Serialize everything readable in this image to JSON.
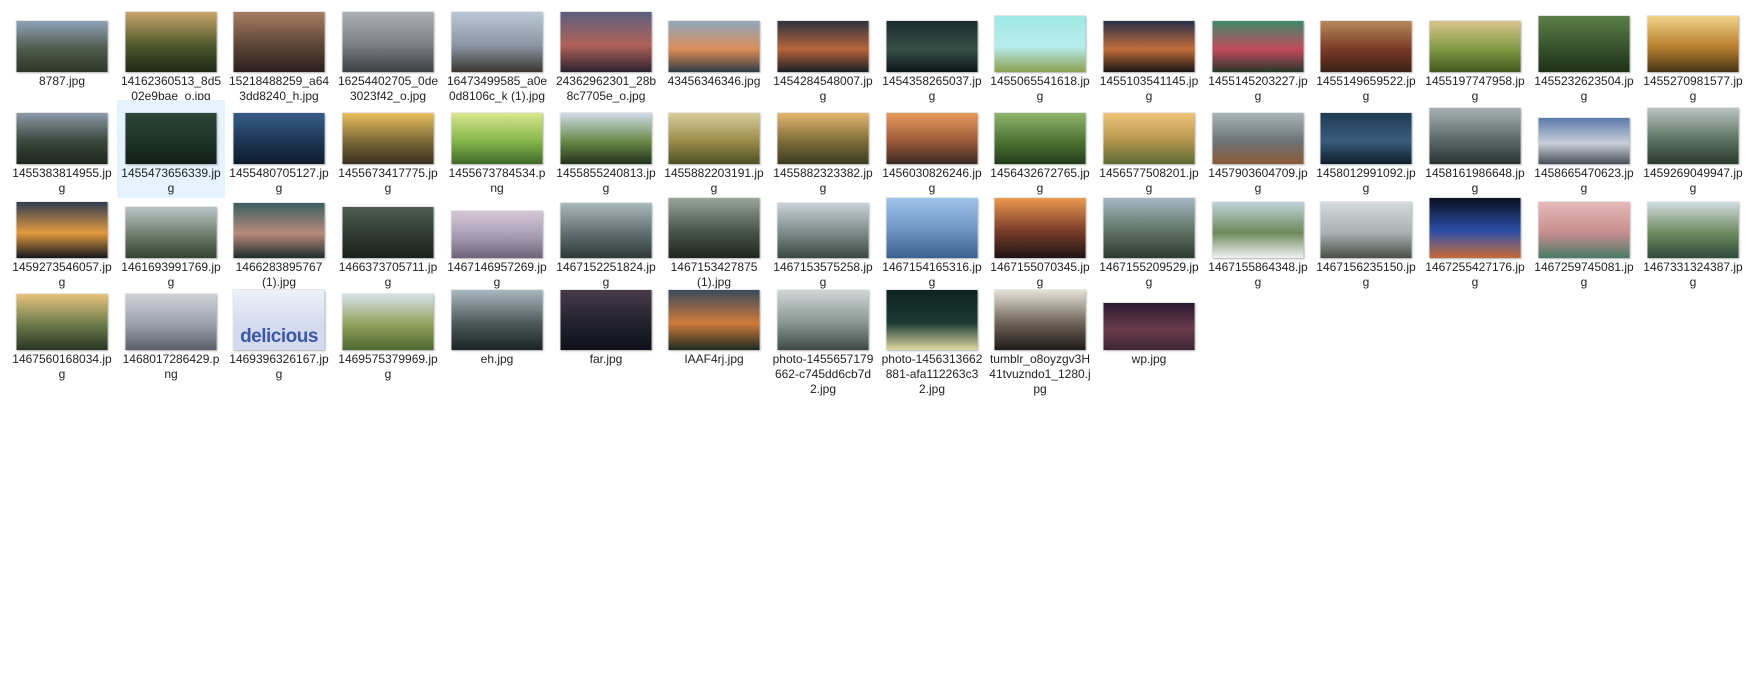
{
  "explorer": {
    "files": [
      {
        "name": "8787.jpg",
        "colors": [
          "#8fa3b8",
          "#4d5a4c",
          "#2e3628"
        ],
        "ratio": 0.56
      },
      {
        "name": "14162360513_8d502e9bae_o.jpg",
        "colors": [
          "#c9a469",
          "#4f5a2c",
          "#1f2716"
        ],
        "ratio": 1.0
      },
      {
        "name": "15218488259_a643dd8240_h.jpg",
        "colors": [
          "#a77e63",
          "#5d4639",
          "#2a1f1c"
        ],
        "ratio": 0.66
      },
      {
        "name": "16254402705_0de3023f42_o.jpg",
        "colors": [
          "#adb1b6",
          "#7b7f86",
          "#3c3e42"
        ],
        "ratio": 0.66
      },
      {
        "name": "16473499585_a0e0d8106c_k (1).jpg",
        "colors": [
          "#b9c7d7",
          "#8b97a6",
          "#3b3631"
        ],
        "ratio": 0.66
      },
      {
        "name": "24362962301_28b8c7705e_o.jpg",
        "colors": [
          "#5b5f7d",
          "#b0625a",
          "#2c2230"
        ],
        "ratio": 0.66
      },
      {
        "name": "43456346346.jpg",
        "colors": [
          "#8fa9be",
          "#dc8d56",
          "#2f3b46"
        ],
        "ratio": 0.56
      },
      {
        "name": "1454284548007.jpg",
        "colors": [
          "#2c3340",
          "#b8653a",
          "#1b1e22"
        ],
        "ratio": 0.56
      },
      {
        "name": "1454358265037.jpg",
        "colors": [
          "#1b2a2f",
          "#375047",
          "#0f1517"
        ],
        "ratio": 0.56
      },
      {
        "name": "1455065541618.jpg",
        "colors": [
          "#9fe9e5",
          "#b7ecec",
          "#8b9f4e"
        ],
        "ratio": 0.62
      },
      {
        "name": "1455103541145.jpg",
        "colors": [
          "#27304a",
          "#c16c3a",
          "#1a1616"
        ],
        "ratio": 0.56
      },
      {
        "name": "1455145203227.jpg",
        "colors": [
          "#3d8a6a",
          "#c34a5a",
          "#28382c"
        ],
        "ratio": 0.56
      },
      {
        "name": "1455149659522.jpg",
        "colors": [
          "#b58a5a",
          "#7b3a26",
          "#3a2218"
        ],
        "ratio": 0.56
      },
      {
        "name": "1455197747958.jpg",
        "colors": [
          "#d9c48c",
          "#809a44",
          "#44581f"
        ],
        "ratio": 0.56
      },
      {
        "name": "1455232623504.jpg",
        "colors": [
          "#5c7e49",
          "#38542c",
          "#1f3118"
        ],
        "ratio": 0.62
      },
      {
        "name": "1455270981577.jpg",
        "colors": [
          "#f1d287",
          "#b8802f",
          "#463316"
        ],
        "ratio": 0.62
      },
      {
        "name": "1455383814955.jpg",
        "colors": [
          "#8b9aa8",
          "#39483c",
          "#1e2620"
        ],
        "ratio": 0.56
      },
      {
        "name": "1455473656339.jpg",
        "colors": [
          "#2c4638",
          "#1e3326",
          "#102016"
        ],
        "ratio": 0.56
      },
      {
        "name": "1455480705127.jpg",
        "colors": [
          "#365d89",
          "#1e3656",
          "#0f1c2e"
        ],
        "ratio": 0.56
      },
      {
        "name": "1455673417775.jpg",
        "colors": [
          "#e9be5e",
          "#7d6938",
          "#3a3020"
        ],
        "ratio": 0.56
      },
      {
        "name": "1455673784534.png",
        "colors": [
          "#d8e68d",
          "#85b64a",
          "#3f6a28"
        ],
        "ratio": 0.56
      },
      {
        "name": "1455855240813.jpg",
        "colors": [
          "#cfdbe7",
          "#6a8a4a",
          "#24341b"
        ],
        "ratio": 0.56
      },
      {
        "name": "1455882203191.jpg",
        "colors": [
          "#d7cc9b",
          "#9c8c4a",
          "#4e5026"
        ],
        "ratio": 0.56
      },
      {
        "name": "1455882323382.jpg",
        "colors": [
          "#e3b56c",
          "#7f6d3a",
          "#3a3c20"
        ],
        "ratio": 0.56
      },
      {
        "name": "1456030826246.jpg",
        "colors": [
          "#e99a5a",
          "#9b5a3a",
          "#3c2a22"
        ],
        "ratio": 0.56
      },
      {
        "name": "1456432672765.jpg",
        "colors": [
          "#8fb46c",
          "#4d7434",
          "#233d1a"
        ],
        "ratio": 0.56
      },
      {
        "name": "1456577508201.jpg",
        "colors": [
          "#f0c478",
          "#b3944d",
          "#5b6a34"
        ],
        "ratio": 0.56
      },
      {
        "name": "1457903604709.jpg",
        "colors": [
          "#a9b4b9",
          "#6c7477",
          "#8a5a36"
        ],
        "ratio": 0.56
      },
      {
        "name": "1458012991092.jpg",
        "colors": [
          "#1f3b55",
          "#3a5c7b",
          "#0f1e2d"
        ],
        "ratio": 0.56
      },
      {
        "name": "1458161986648.jpg",
        "colors": [
          "#a7b1b4",
          "#5d6c69",
          "#2a3432"
        ],
        "ratio": 0.62
      },
      {
        "name": "1458665470623.jpg",
        "colors": [
          "#5a7aa9",
          "#c9cfd8",
          "#4a4e58"
        ],
        "ratio": 0.5
      },
      {
        "name": "1459269049947.jpg",
        "colors": [
          "#b9c4c4",
          "#5e7464",
          "#2a3a2e"
        ],
        "ratio": 0.62
      },
      {
        "name": "1459273546057.jpg",
        "colors": [
          "#2f3d52",
          "#e39a3e",
          "#141820"
        ],
        "ratio": 0.62
      },
      {
        "name": "1461693991769.jpg",
        "colors": [
          "#b8c6c8",
          "#6a7e6a",
          "#344232"
        ],
        "ratio": 0.56
      },
      {
        "name": "1466283895767 (1).jpg",
        "colors": [
          "#3a5f5e",
          "#b88a7c",
          "#1f2d2e"
        ],
        "ratio": 0.6
      },
      {
        "name": "1466373705711.jpg",
        "colors": [
          "#4e5c50",
          "#2f3a32",
          "#1a221c"
        ],
        "ratio": 0.56
      },
      {
        "name": "1467146957269.jpg",
        "colors": [
          "#d5c8d6",
          "#a59bb3",
          "#6e6278"
        ],
        "ratio": 0.52
      },
      {
        "name": "1467152251824.jpg",
        "colors": [
          "#aab9bc",
          "#5f6f70",
          "#2e3838"
        ],
        "ratio": 0.6
      },
      {
        "name": "1467153427875 (1).jpg",
        "colors": [
          "#9aa59a",
          "#4a564a",
          "#1e261e"
        ],
        "ratio": 0.66
      },
      {
        "name": "1467153575258.jpg",
        "colors": [
          "#c9d2da",
          "#7a8a86",
          "#3a4642"
        ],
        "ratio": 0.6
      },
      {
        "name": "1467154165316.jpg",
        "colors": [
          "#9fc3ea",
          "#6e93c2",
          "#3b5f8e"
        ],
        "ratio": 0.66
      },
      {
        "name": "1467155070345.jpg",
        "colors": [
          "#ec9a50",
          "#7a3c2a",
          "#1e1414"
        ],
        "ratio": 0.66
      },
      {
        "name": "1467155209529.jpg",
        "colors": [
          "#a6b8c4",
          "#5f7264",
          "#2c3a30"
        ],
        "ratio": 0.66
      },
      {
        "name": "1467155864348.jpg",
        "colors": [
          "#bfd3dc",
          "#6e8a5a",
          "#eef2f3"
        ],
        "ratio": 0.62
      },
      {
        "name": "1467156235150.jpg",
        "colors": [
          "#d5dadc",
          "#a9b0b2",
          "#4a5048"
        ],
        "ratio": 0.62
      },
      {
        "name": "1467255427176.jpg",
        "colors": [
          "#0b1020",
          "#2a4fa8",
          "#c86a3a"
        ],
        "ratio": 0.66
      },
      {
        "name": "1467259745081.jpg",
        "colors": [
          "#e7b9b8",
          "#c88e90",
          "#4a7a66"
        ],
        "ratio": 0.62
      },
      {
        "name": "1467331324387.jpg",
        "colors": [
          "#d0dcdf",
          "#6e8a60",
          "#2f4a3a"
        ],
        "ratio": 0.62
      },
      {
        "name": "1467560168034.jpg",
        "colors": [
          "#e6c37c",
          "#6a7a4a",
          "#2a3424"
        ],
        "ratio": 0.62
      },
      {
        "name": "1468017286429.png",
        "colors": [
          "#cfd1d8",
          "#9aa0aa",
          "#5a5f6a"
        ],
        "ratio": 0.62
      },
      {
        "name": "1469396326167.jpg",
        "colors": [
          "#eef1f8",
          "#d4dbee",
          "#3c58a6"
        ],
        "ratio": 0.82,
        "logo": "delicious"
      },
      {
        "name": "1469575379969.jpg",
        "colors": [
          "#d7e0e8",
          "#8fa25a",
          "#4f6630"
        ],
        "ratio": 0.62
      },
      {
        "name": "eh.jpg",
        "colors": [
          "#a8b8c0",
          "#4e5a5a",
          "#1c2424"
        ],
        "ratio": 0.66
      },
      {
        "name": "far.jpg",
        "colors": [
          "#4a3a4a",
          "#22222e",
          "#10101a"
        ],
        "ratio": 0.66
      },
      {
        "name": "IAAF4rj.jpg",
        "colors": [
          "#3a4a5e",
          "#d07a3a",
          "#1e2a22"
        ],
        "ratio": 0.66
      },
      {
        "name": "photo-1455657179662-c745dd6cb7d2.jpg",
        "colors": [
          "#cfd6d6",
          "#8a9690",
          "#3e4a46"
        ],
        "ratio": 0.66
      },
      {
        "name": "photo-1456313662881-afa112263c32.jpg",
        "colors": [
          "#0f2320",
          "#1c3a34",
          "#e0d8a0"
        ],
        "ratio": 0.66
      },
      {
        "name": "tumblr_o8oyzgv3H41tvuzndo1_1280.jpg",
        "colors": [
          "#e6e2d8",
          "#6e6458",
          "#1e1a16"
        ],
        "ratio": 0.66
      },
      {
        "name": "wp.jpg",
        "colors": [
          "#2a1a30",
          "#6a3a4a",
          "#3c2632"
        ],
        "ratio": 0.52
      }
    ],
    "selected_index": 17
  }
}
